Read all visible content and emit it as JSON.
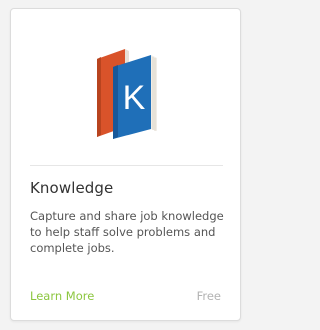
{
  "card": {
    "icon": "knowledge-book-icon",
    "icon_letter": "K",
    "title": "Knowledge",
    "description": "Capture and share job knowledge to help staff solve problems and complete jobs.",
    "learn_more_label": "Learn More",
    "price_label": "Free"
  },
  "colors": {
    "accent_link": "#8cc63f",
    "price_text": "#b3b3b3",
    "book_blue": "#1e73be",
    "book_orange": "#e05a2b"
  }
}
